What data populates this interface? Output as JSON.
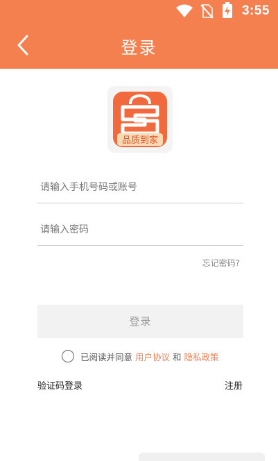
{
  "status_bar": {
    "time": "3:55",
    "icons": [
      "wifi-icon",
      "no-sim-icon",
      "battery-charging-icon"
    ]
  },
  "header": {
    "title": "登录",
    "back_icon": "chevron-left-icon",
    "background": "#f47f4f"
  },
  "logo": {
    "caption": "品质到家",
    "brand_color": "#f06a3d"
  },
  "form": {
    "account_placeholder": "请输入手机号码或账号",
    "password_placeholder": "请输入密码",
    "forgot_link": "忘记密码?",
    "login_button": "登录"
  },
  "agreement": {
    "prefix": "已阅读并同意",
    "user_agreement": "用户协议",
    "and": "和",
    "privacy_policy": "隐私政策",
    "link_color": "#f47f4f"
  },
  "footer": {
    "sms_login": "验证码登录",
    "register": "注册"
  }
}
